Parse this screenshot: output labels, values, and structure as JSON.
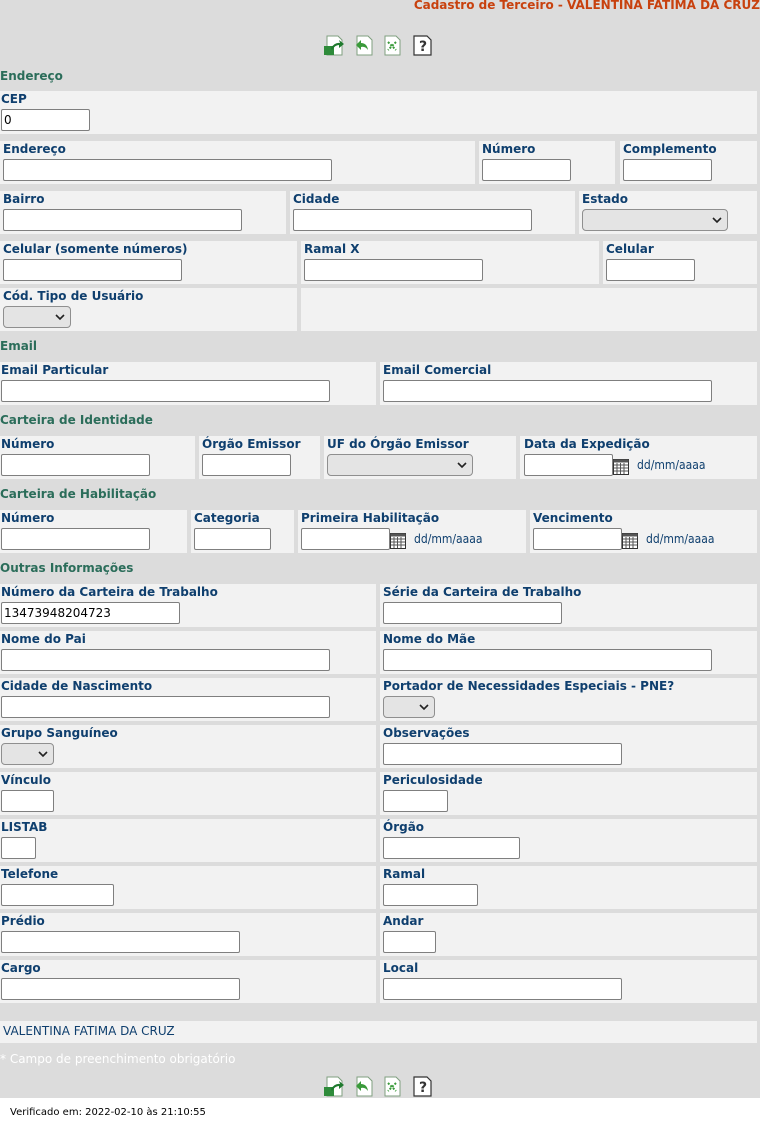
{
  "header": {
    "title": "Cadastro de Terceiro - VALENTINA FATIMA DA CRUZ"
  },
  "icons": {
    "save": "save-icon",
    "back": "back-icon",
    "cancel": "cancel-icon",
    "help": "help-icon"
  },
  "colors": {
    "background": "#dcdcdc",
    "cell": "#f2f2f2",
    "title": "#c8410e",
    "section": "#2b6d5a",
    "label": "#0f3f6e"
  },
  "sections": {
    "endereco": "Endereço",
    "email": "Email",
    "identidade": "Carteira de Identidade",
    "habilitacao": "Carteira de Habilitação",
    "outras": "Outras Informações"
  },
  "endereco": {
    "cep": {
      "label": "CEP",
      "value": "0"
    },
    "endereco": {
      "label": "Endereço",
      "value": ""
    },
    "numero": {
      "label": "Número",
      "value": ""
    },
    "complemento": {
      "label": "Complemento",
      "value": ""
    },
    "bairro": {
      "label": "Bairro",
      "value": ""
    },
    "cidade": {
      "label": "Cidade",
      "value": ""
    },
    "estado": {
      "label": "Estado"
    },
    "celular_num": {
      "label": "Celular (somente números)",
      "value": ""
    },
    "ramal_x": {
      "label": "Ramal X",
      "value": ""
    },
    "celular": {
      "label": "Celular",
      "value": ""
    },
    "tipo_usuario": {
      "label": "Cód. Tipo de Usuário"
    }
  },
  "email": {
    "particular": {
      "label": "Email Particular",
      "value": ""
    },
    "comercial": {
      "label": "Email Comercial",
      "value": ""
    }
  },
  "identidade": {
    "numero": {
      "label": "Número",
      "value": ""
    },
    "orgao": {
      "label": "Órgão Emissor",
      "value": ""
    },
    "uf": {
      "label": "UF do Órgão Emissor"
    },
    "data": {
      "label": "Data da Expedição",
      "value": "",
      "hint": "dd/mm/aaaa"
    }
  },
  "habilitacao": {
    "numero": {
      "label": "Número",
      "value": ""
    },
    "categoria": {
      "label": "Categoria",
      "value": ""
    },
    "primeira": {
      "label": "Primeira Habilitação",
      "value": "",
      "hint": "dd/mm/aaaa"
    },
    "vencimento": {
      "label": "Vencimento",
      "value": "",
      "hint": "dd/mm/aaaa"
    }
  },
  "outras": {
    "ctps_num": {
      "label": "Número da Carteira de Trabalho",
      "value": "13473948204723"
    },
    "ctps_serie": {
      "label": "Série da Carteira de Trabalho",
      "value": ""
    },
    "pai": {
      "label": "Nome do Pai",
      "value": ""
    },
    "mae": {
      "label": "Nome do Mãe",
      "value": ""
    },
    "cidade_nasc": {
      "label": "Cidade de Nascimento",
      "value": ""
    },
    "pne": {
      "label": "Portador de Necessidades Especiais - PNE?"
    },
    "grupo": {
      "label": "Grupo Sanguíneo"
    },
    "obs": {
      "label": "Observações",
      "value": ""
    },
    "vinculo": {
      "label": "Vínculo",
      "value": ""
    },
    "periculosidade": {
      "label": "Periculosidade",
      "value": ""
    },
    "listab": {
      "label": "LISTAB",
      "value": ""
    },
    "orgao": {
      "label": "Órgão",
      "value": ""
    },
    "telefone": {
      "label": "Telefone",
      "value": ""
    },
    "ramal": {
      "label": "Ramal",
      "value": ""
    },
    "predio": {
      "label": "Prédio",
      "value": ""
    },
    "andar": {
      "label": "Andar",
      "value": ""
    },
    "cargo": {
      "label": "Cargo",
      "value": ""
    },
    "local": {
      "label": "Local",
      "value": ""
    }
  },
  "footer": {
    "name": "VALENTINA FATIMA DA CRUZ",
    "required_note": "* Campo de preenchimento obrigatório",
    "verified": "Verificado em: 2022-02-10 às 21:10:55"
  }
}
